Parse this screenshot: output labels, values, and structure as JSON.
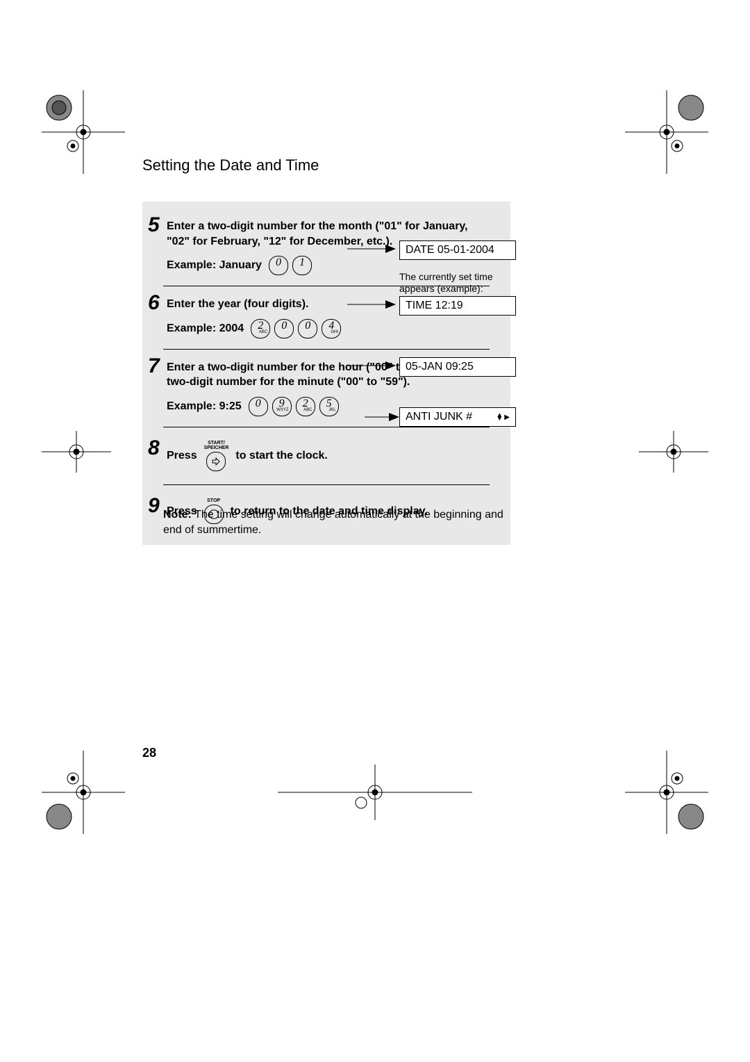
{
  "header": {
    "title": "Setting the Date and Time"
  },
  "steps": {
    "s5": {
      "num": "5",
      "text": "Enter a two-digit number for the month (\"01\" for January, \"02\" for February, \"12\" for December, etc.).",
      "example_label": "Example: January",
      "keys": [
        "0",
        "1"
      ],
      "display": "DATE 05-01-2004"
    },
    "s6": {
      "num": "6",
      "text": "Enter the year (four digits).",
      "example_label": "Example: 2004",
      "keys": [
        {
          "d": "2",
          "sub": "ABC"
        },
        {
          "d": "0",
          "sub": ""
        },
        {
          "d": "0",
          "sub": ""
        },
        {
          "d": "4",
          "sub": "GHI"
        }
      ],
      "side_note": "The currently set time appears (example):",
      "display": "TIME 12:19"
    },
    "s7": {
      "num": "7",
      "text": "Enter a two-digit number for the hour (\"00\" to \"23\") and a two-digit number for the minute (\"00\" to \"59\").",
      "example_label": "Example: 9:25",
      "keys": [
        {
          "d": "0",
          "sub": ""
        },
        {
          "d": "9",
          "sub": "WXYZ"
        },
        {
          "d": "2",
          "sub": "ABC"
        },
        {
          "d": "5",
          "sub": "JKL"
        }
      ],
      "display": "05-JAN 09:25"
    },
    "s8": {
      "num": "8",
      "press": "Press",
      "btn_label": "START/\nSPEICHER",
      "after": "to start the clock.",
      "display": "ANTI JUNK #"
    },
    "s9": {
      "num": "9",
      "press": "Press",
      "btn_label": "STOP",
      "after": "to return to the date and time display."
    }
  },
  "note": {
    "prefix": "Note:",
    "text": " The time setting will change automatically at the beginning and end of summertime."
  },
  "page_number": "28"
}
